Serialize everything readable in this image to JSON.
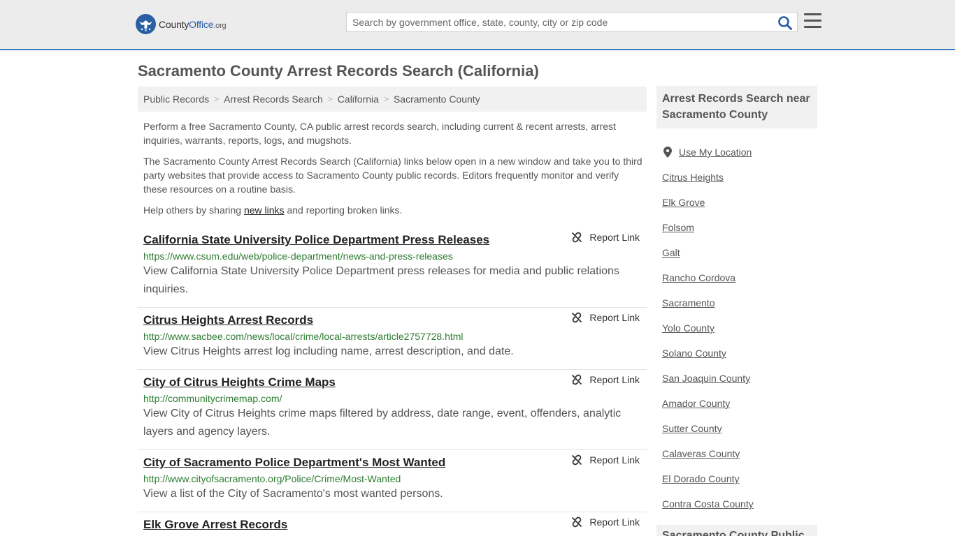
{
  "header": {
    "logo_main": "County",
    "logo_accent": "Office",
    "logo_tld": ".org",
    "search_placeholder": "Search by government office, state, county, city or zip code"
  },
  "page": {
    "title": "Sacramento County Arrest Records Search (California)"
  },
  "breadcrumb": [
    "Public Records",
    "Arrest Records Search",
    "California",
    "Sacramento County"
  ],
  "intro": {
    "p1": "Perform a free Sacramento County, CA public arrest records search, including current & recent arrests, arrest inquiries, warrants, reports, logs, and mugshots.",
    "p2": "The Sacramento County Arrest Records Search (California) links below open in a new window and take you to third party websites that provide access to Sacramento County public records. Editors frequently monitor and verify these resources on a routine basis.",
    "p3_before": "Help others by sharing ",
    "p3_link": "new links",
    "p3_after": " and reporting broken links."
  },
  "report_label": "Report Link",
  "results": [
    {
      "title": "California State University Police Department Press Releases",
      "url": "https://www.csum.edu/web/police-department/news-and-press-releases",
      "desc": "View California State University Police Department press releases for media and public relations inquiries."
    },
    {
      "title": "Citrus Heights Arrest Records",
      "url": "http://www.sacbee.com/news/local/crime/local-arrests/article2757728.html",
      "desc": "View Citrus Heights arrest log including name, arrest description, and date."
    },
    {
      "title": "City of Citrus Heights Crime Maps",
      "url": "http://communitycrimemap.com/",
      "desc": "View City of Citrus Heights crime maps filtered by address, date range, event, offenders, analytic layers and agency layers."
    },
    {
      "title": "City of Sacramento Police Department's Most Wanted",
      "url": "http://www.cityofsacramento.org/Police/Crime/Most-Wanted",
      "desc": "View a list of the City of Sacramento's most wanted persons."
    },
    {
      "title": "Elk Grove Arrest Records",
      "url": "",
      "desc": ""
    }
  ],
  "sidebar": {
    "heading": "Arrest Records Search near Sacramento County",
    "use_location": "Use My Location",
    "links": [
      "Citrus Heights",
      "Elk Grove",
      "Folsom",
      "Galt",
      "Rancho Cordova",
      "Sacramento",
      "Yolo County",
      "Solano County",
      "San Joaquin County",
      "Amador County",
      "Sutter County",
      "Calaveras County",
      "El Dorado County",
      "Contra Costa County"
    ],
    "heading2": "Sacramento County Public"
  },
  "colors": {
    "accent_blue": "#2a5fa3",
    "url_green": "#2e7d32",
    "header_bg": "#ececec"
  }
}
